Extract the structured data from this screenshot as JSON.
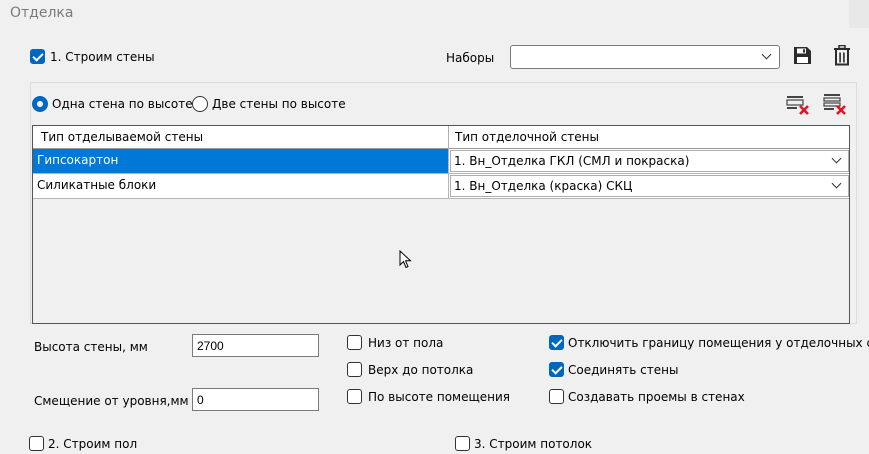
{
  "window": {
    "title": "Отделка"
  },
  "section_walls": {
    "label": "1. Строим стены",
    "checked": true
  },
  "presets": {
    "label": "Наборы",
    "value": ""
  },
  "radios": {
    "one_wall": {
      "label": "Одна стена по высоте",
      "selected": true
    },
    "two_walls": {
      "label": "Две стены по высоте",
      "selected": false
    }
  },
  "table": {
    "headers": [
      "Тип отделываемой стены",
      "Тип отделочной стены"
    ],
    "rows": [
      {
        "wall_type": "Гипсокартон",
        "finish_type": "1. Вн_Отделка ГКЛ (СМЛ и покраска)",
        "selected": true
      },
      {
        "wall_type": "Силикатные блоки",
        "finish_type": "1. Вн_Отделка (краска) СКЦ",
        "selected": false
      }
    ]
  },
  "wall_height": {
    "label": "Высота стены, мм",
    "value": "2700"
  },
  "level_offset": {
    "label": "Смещение от уровня,мм",
    "value": "0"
  },
  "options": {
    "bottom_from_floor": {
      "label": "Низ от пола",
      "checked": false
    },
    "top_to_ceiling": {
      "label": "Верх до потолка",
      "checked": false
    },
    "by_room_height": {
      "label": "По высоте помещения",
      "checked": false
    },
    "disable_room_boundary": {
      "label": "Отключить границу помещения у отделочных стен",
      "checked": true
    },
    "join_walls": {
      "label": "Соединять стены",
      "checked": true
    },
    "create_openings": {
      "label": "Создавать проемы в стенах",
      "checked": false
    }
  },
  "section_floor": {
    "label": "2. Строим пол",
    "checked": false
  },
  "section_ceiling": {
    "label": "3. Строим потолок",
    "checked": false
  },
  "icons": {
    "save": "save-icon",
    "delete": "trash-icon",
    "clear_row": "delete-row-icon",
    "clear_all": "delete-all-icon"
  },
  "colors": {
    "accent": "#0078d7",
    "check": "#0067c0",
    "delete_red": "#e81123"
  }
}
